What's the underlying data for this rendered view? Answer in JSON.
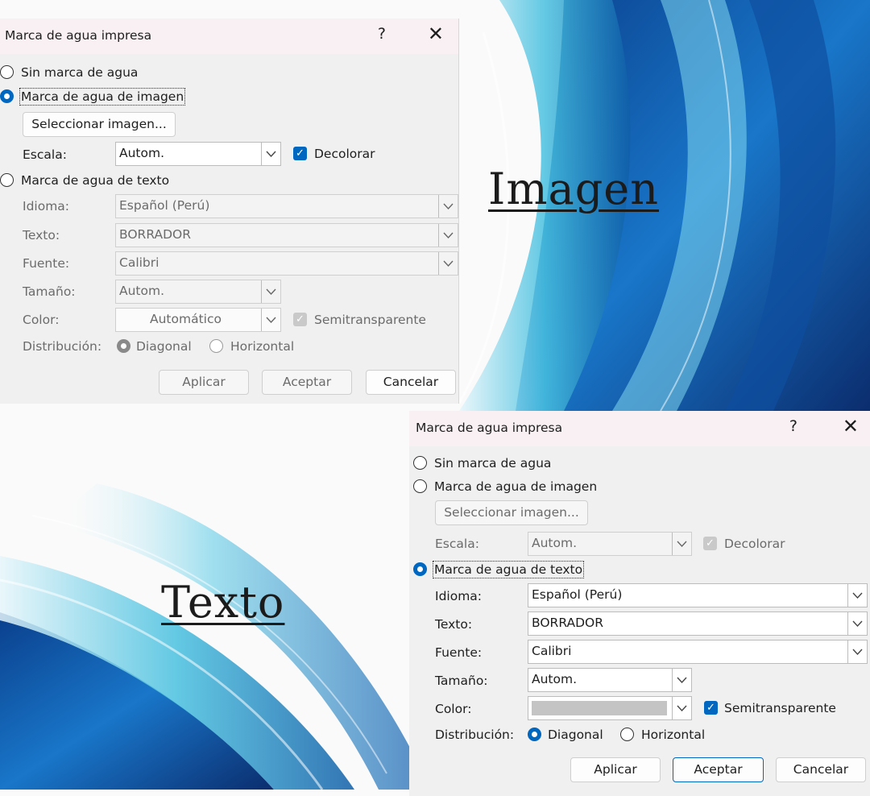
{
  "labels": {
    "image": "Imagen",
    "text": "Texto"
  },
  "dialog_image": {
    "title": "Marca de agua impresa",
    "help": "?",
    "close": "✕",
    "no_watermark": "Sin marca de agua",
    "image_watermark": "Marca de agua de imagen",
    "select_image": "Seleccionar imagen...",
    "scale_label": "Escala:",
    "scale_value": "Autom.",
    "washout_label": "Decolorar",
    "text_watermark": "Marca de agua de texto",
    "language_label": "Idioma:",
    "language_value": "Español (Perú)",
    "text_label": "Texto:",
    "text_value": "BORRADOR",
    "font_label": "Fuente:",
    "font_value": "Calibri",
    "size_label": "Tamaño:",
    "size_value": "Autom.",
    "color_label": "Color:",
    "color_value": "Automático",
    "semitransparent_label": "Semitransparente",
    "layout_label": "Distribución:",
    "diagonal": "Diagonal",
    "horizontal": "Horizontal",
    "apply": "Aplicar",
    "ok": "Aceptar",
    "cancel": "Cancelar"
  },
  "dialog_text": {
    "title": "Marca de agua impresa",
    "help": "?",
    "close": "✕",
    "no_watermark": "Sin marca de agua",
    "image_watermark": "Marca de agua de imagen",
    "select_image": "Seleccionar imagen...",
    "scale_label": "Escala:",
    "scale_value": "Autom.",
    "washout_label": "Decolorar",
    "text_watermark": "Marca de agua de texto",
    "language_label": "Idioma:",
    "language_value": "Español (Perú)",
    "text_label": "Texto:",
    "text_value": "BORRADOR",
    "font_label": "Fuente:",
    "font_value": "Calibri",
    "size_label": "Tamaño:",
    "size_value": "Autom.",
    "color_label": "Color:",
    "semitransparent_label": "Semitransparente",
    "layout_label": "Distribución:",
    "diagonal": "Diagonal",
    "horizontal": "Horizontal",
    "apply": "Aplicar",
    "ok": "Aceptar",
    "cancel": "Cancelar"
  },
  "colors": {
    "accent": "#0067c0",
    "title_bar": "#f8f0f2",
    "dialog_bg": "#f0f0f0"
  }
}
